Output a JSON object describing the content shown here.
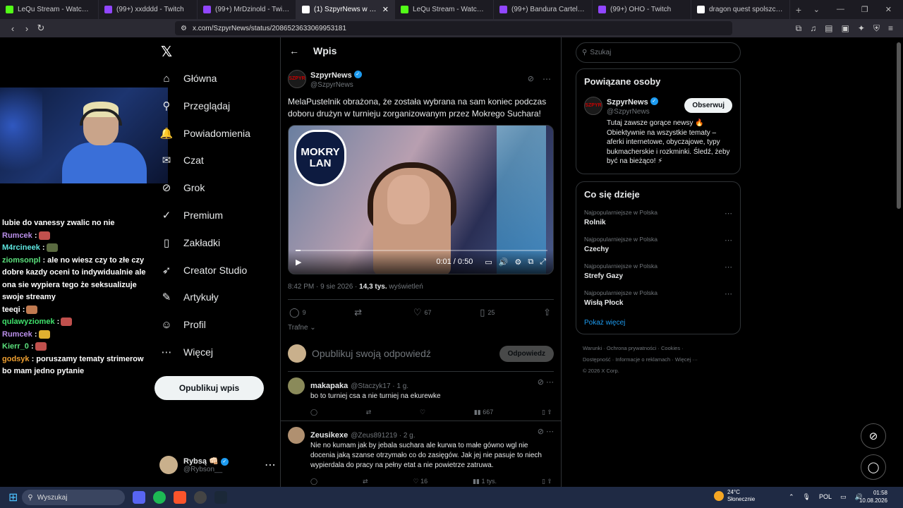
{
  "browser": {
    "tabs": [
      {
        "title": "LeQu Stream - Watch Live on",
        "color": "#53fc18"
      },
      {
        "title": "(99+) xxdddd - Twitch",
        "color": "#9146ff"
      },
      {
        "title": "(99+) MrDzinold - Twitch",
        "color": "#9146ff"
      },
      {
        "title": "(1) SzpyrNews w serwisie",
        "color": "#ffffff",
        "active": true
      },
      {
        "title": "LeQu Stream - Watch Live on",
        "color": "#53fc18"
      },
      {
        "title": "(99+) Bandura Cartel - Twitch",
        "color": "#9146ff"
      },
      {
        "title": "(99+) OHO - Twitch",
        "color": "#9146ff"
      },
      {
        "title": "dragon quest spolszczenie -",
        "color": "#ffffff"
      }
    ],
    "url": "x.com/SzpyrNews/status/2086523633069953181"
  },
  "chat": [
    {
      "name": "",
      "text": "lubie do vanessy zwalic no nie",
      "color": "#ffffff"
    },
    {
      "name": "Rumcek",
      "text": ":",
      "color": "#b98ee8",
      "emote": "#c0504d"
    },
    {
      "name": "M4rcineek",
      "text": ":",
      "color": "#5ee6e0",
      "emote": "#5a6a40"
    },
    {
      "name": "ziomsonpl",
      "text": ": ale no wiesz czy to złe czy dobre kazdy oceni to indywidualnie ale ona sie wypiera tego że seksualizuje swoje streamy",
      "color": "#5be07c"
    },
    {
      "name": "teeqi",
      "text": ":",
      "color": "#ffffff",
      "emote": "#c07a50"
    },
    {
      "name": "qulawyziomek",
      "text": ":",
      "color": "#3fe06b",
      "emote": "#c0504d"
    },
    {
      "name": "Rumcek",
      "text": ":",
      "color": "#b98ee8",
      "emote": "#e0b030"
    },
    {
      "name": "Kierr_0",
      "text": ":",
      "color": "#5be07c",
      "emote": "#c0504d"
    },
    {
      "name": "godsyk",
      "text": ": poruszamy tematy strimerow bo mam jedno pytanie",
      "color": "#f0a030"
    }
  ],
  "nav": {
    "logo": "𝕏",
    "items": [
      {
        "label": "Główna",
        "icon": "home-icon",
        "glyph": "⌂"
      },
      {
        "label": "Przeglądaj",
        "icon": "search-icon",
        "glyph": "⚲"
      },
      {
        "label": "Powiadomienia",
        "icon": "bell-icon",
        "glyph": "🔔"
      },
      {
        "label": "Czat",
        "icon": "chat-icon",
        "glyph": "✉"
      },
      {
        "label": "Grok",
        "icon": "grok-icon",
        "glyph": "⊘"
      },
      {
        "label": "Premium",
        "icon": "verified-icon",
        "glyph": "✓"
      },
      {
        "label": "Zakładki",
        "icon": "bookmark-icon",
        "glyph": "▯"
      },
      {
        "label": "Creator Studio",
        "icon": "rocket-icon",
        "glyph": "➶"
      },
      {
        "label": "Artykuły",
        "icon": "article-icon",
        "glyph": "✎"
      },
      {
        "label": "Profil",
        "icon": "profile-icon",
        "glyph": "☺"
      },
      {
        "label": "Więcej",
        "icon": "more-icon",
        "glyph": "⋯"
      }
    ],
    "post_button": "Opublikuj wpis",
    "account_name": "Rybsą 👊🏻",
    "account_handle": "@Rybson__"
  },
  "main": {
    "header_title": "Wpis",
    "author_name": "SzpyrNews",
    "author_handle": "@SzpyrNews",
    "avatar_text": "SZPYR",
    "text": "MelaPustelnik obrażona, że została wybrana na sam koniec podczas doboru drużyn w turnieju zorganizowanym przez Mokrego Suchara!",
    "video": {
      "logo_line1": "MOKRY",
      "logo_line2": "LAN",
      "time": "0:01 / 0:50",
      "progress": 0.02
    },
    "meta_time": "8:42 PM · 9 sie 2026 · ",
    "meta_views": "14,3 tys.",
    "meta_views_label": " wyświetleń",
    "stats": {
      "replies": "9",
      "reposts": "",
      "likes": "67",
      "bookmarks": "25"
    },
    "sort_label": "Trafne",
    "reply_placeholder": "Opublikuj swoją odpowiedź",
    "reply_button": "Odpowiedz",
    "replies": [
      {
        "name": "makapaka",
        "handle": "@Staczyk17 · 1 g.",
        "text": "bo to turniej csa a nie turniej na ekurewke",
        "views": "667",
        "likes": "",
        "avatar": "#8a8a5a"
      },
      {
        "name": "Zeusikexe",
        "handle": "@Zeus891219 · 2 g.",
        "text": "Nie no kumam jak by jebala suchara ale kurwa to małe gówno wgl nie docenia jaką szanse otrzymało co do zasięgów. Jak jej nie pasuje to niech wypierdala do pracy na pełny etat a nie powietrze zatruwa.",
        "views": "1 tys.",
        "likes": "16",
        "avatar": "#b09070"
      }
    ]
  },
  "sidebar": {
    "search_placeholder": "Szukaj",
    "related_title": "Powiązane osoby",
    "follow_label": "Obserwuj",
    "bio": "Tutaj zawsze gorące newsy 🔥 Obiektywnie na wszystkie tematy – aferki internetowe, obyczajowe, typy bukmacherskie i rozkminki. Śledź, żeby być na bieżąco! ⚡",
    "trends_title": "Co się dzieje",
    "trends": [
      {
        "context": "Najpopularniejsze w Polska",
        "name": "Rolnik"
      },
      {
        "context": "Najpopularniejsze w Polska",
        "name": "Czechy"
      },
      {
        "context": "Najpopularniejsze w Polska",
        "name": "Strefy Gazy"
      },
      {
        "context": "Najpopularniejsze w Polska",
        "name": "Wisłą Płock"
      }
    ],
    "show_more": "Pokaż więcej",
    "footer_line1": "Warunki · Ochrona prywatności · Cookies ·",
    "footer_line2": "Dostępność · Informacje o reklamach · Więcej ···",
    "footer_line3": "© 2026 X Corp."
  },
  "taskbar": {
    "search": "Wyszukaj",
    "temp": "24°C",
    "weather": "Słonecznie",
    "lang": "POL",
    "time": "01:58",
    "date": "10.08.2026"
  }
}
